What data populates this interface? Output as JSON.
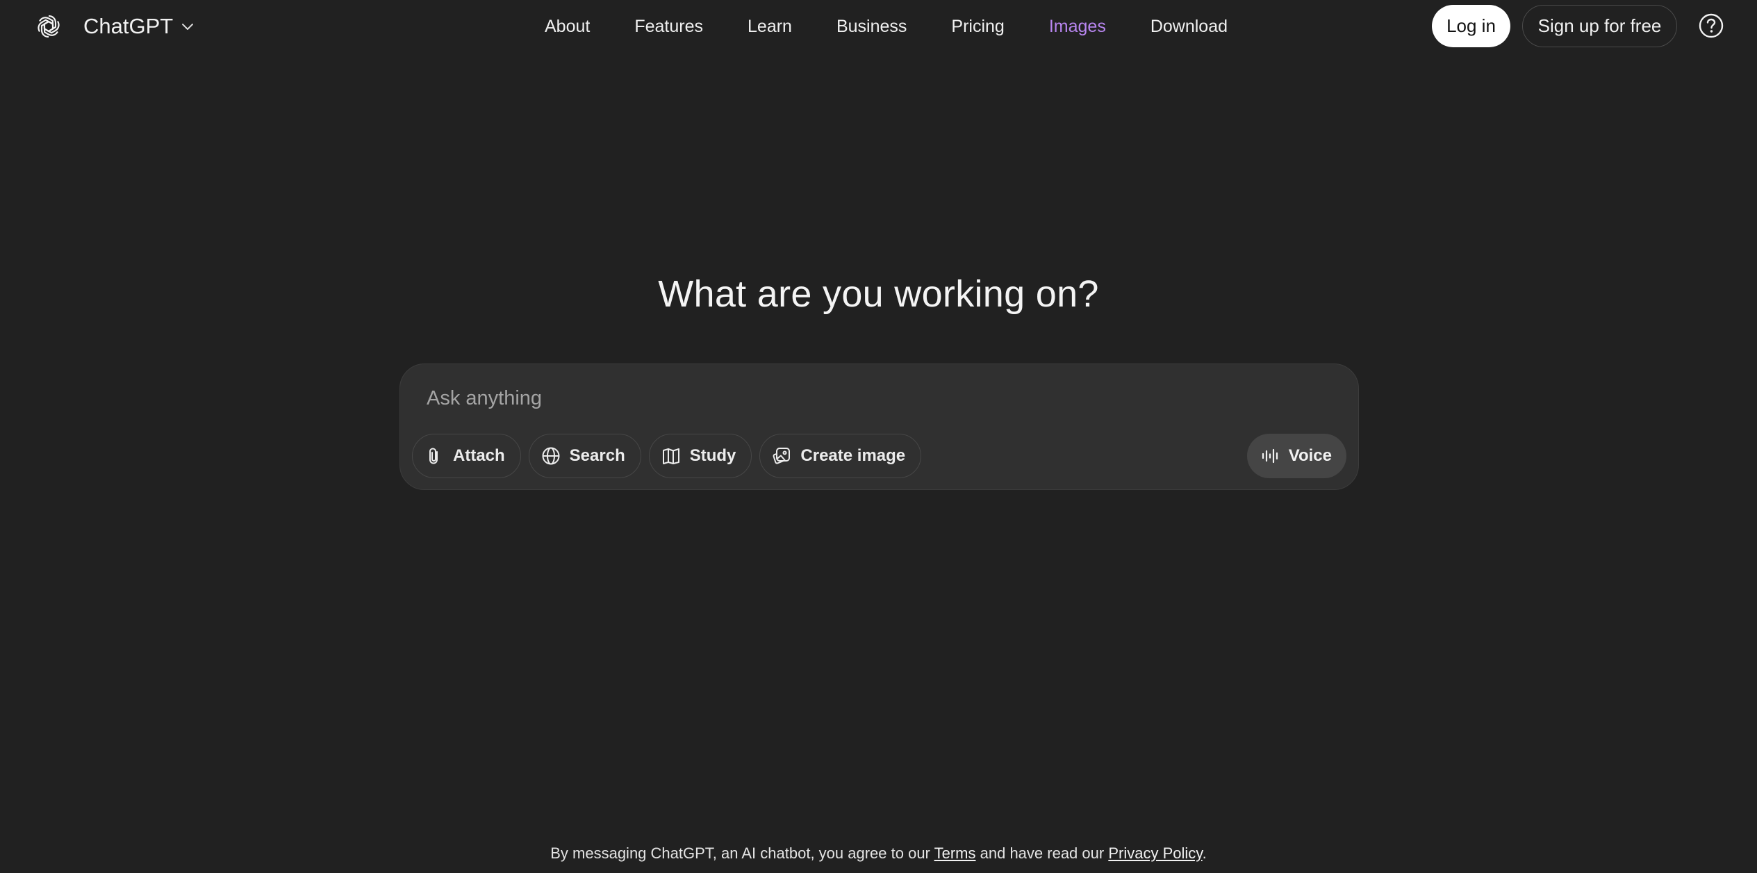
{
  "brand": {
    "name": "ChatGPT"
  },
  "nav": {
    "items": [
      {
        "label": "About"
      },
      {
        "label": "Features"
      },
      {
        "label": "Learn"
      },
      {
        "label": "Business"
      },
      {
        "label": "Pricing"
      },
      {
        "label": "Images",
        "active": true
      },
      {
        "label": "Download"
      }
    ]
  },
  "auth": {
    "login_label": "Log in",
    "signup_label": "Sign up for free"
  },
  "main": {
    "headline": "What are you working on?",
    "composer": {
      "placeholder": "Ask anything",
      "value": "",
      "tools": [
        {
          "label": "Attach",
          "icon": "paperclip-icon"
        },
        {
          "label": "Search",
          "icon": "globe-icon"
        },
        {
          "label": "Study",
          "icon": "book-icon"
        },
        {
          "label": "Create image",
          "icon": "image-icon"
        }
      ],
      "voice_label": "Voice"
    }
  },
  "footer": {
    "prefix": "By messaging ChatGPT, an AI chatbot, you agree to our",
    "terms_label": "Terms",
    "middle": "and have read our",
    "privacy_label": "Privacy Policy",
    "suffix": "."
  },
  "colors": {
    "background": "#212121",
    "composer": "#303030",
    "active_nav": "#b886f0",
    "primary_button": "#ffffff"
  }
}
